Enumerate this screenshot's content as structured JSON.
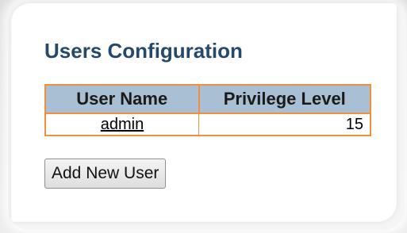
{
  "page": {
    "title": "Users Configuration"
  },
  "table": {
    "headers": [
      "User Name",
      "Privilege Level"
    ],
    "rows": [
      {
        "user_name": "admin",
        "privilege_level": "15"
      }
    ]
  },
  "actions": {
    "add_user_label": "Add New User"
  },
  "colors": {
    "title": "#25496b",
    "header_bg": "#a9bfd3",
    "table_border": "#f08f3e"
  }
}
